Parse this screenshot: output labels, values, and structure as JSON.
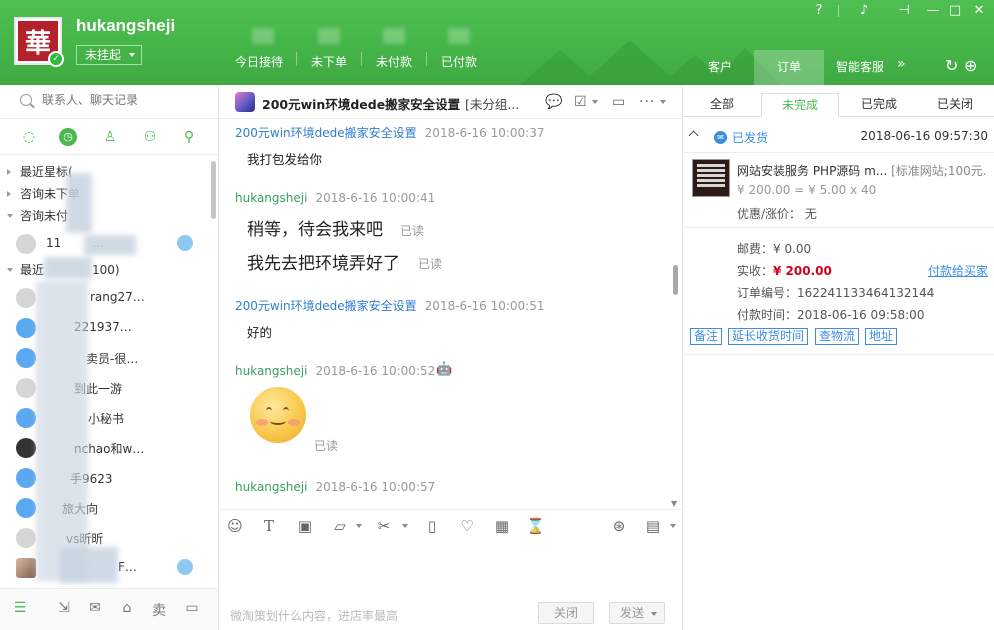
{
  "window": {
    "username": "hukangsheji",
    "avatar_char": "華",
    "status": "未挂起",
    "stats": [
      "今日接待",
      "未下单",
      "未付款",
      "已付款"
    ],
    "tabs": [
      "客户",
      "订单",
      "智能客服"
    ],
    "active_tab": "订单",
    "controls": [
      "help-icon",
      "sound-icon",
      "pin-icon",
      "minimize-icon",
      "maximize-icon",
      "close-icon"
    ]
  },
  "sidebar": {
    "search_placeholder": "联系人、聊天记录",
    "groups": [
      {
        "label": "最近星标(",
        "expanded": false
      },
      {
        "label": "咨询未下单",
        "expanded": false
      },
      {
        "label": "咨询未付",
        "expanded": true
      },
      {
        "label": "最近",
        "count": "100)",
        "expanded": true
      }
    ],
    "contacts": [
      {
        "name": "11",
        "suffix": "…"
      },
      {
        "name": "rang27…"
      },
      {
        "name": "221937…"
      },
      {
        "name": "卖员-很…"
      },
      {
        "name": "到此一游"
      },
      {
        "name": "小秘书"
      },
      {
        "name": "nchao和w…"
      },
      {
        "name": "手9623"
      },
      {
        "name": "旅大向"
      },
      {
        "name": "vs昕昕"
      },
      {
        "name": "F…"
      }
    ]
  },
  "chat": {
    "title": "200元win环境dede搬家安全设置",
    "title_suffix": "[未分组...",
    "messages": [
      {
        "sender": "200元win环境dede搬家安全设置",
        "time": "2018-6-16 10:00:37",
        "text": "我打包发给你"
      },
      {
        "sender": "hukangsheji",
        "time": "2018-6-16 10:00:41",
        "lines": [
          "稍等，待会我来吧",
          "我先去把环境弄好了"
        ],
        "read": "已读"
      },
      {
        "sender": "200元win环境dede搬家安全设置",
        "time": "2018-6-16 10:00:51",
        "text": "好的"
      },
      {
        "sender": "hukangsheji",
        "time": "2018-6-16 10:00:52",
        "read": "已读"
      },
      {
        "sender": "hukangsheji",
        "time": "2018-6-16 10:00:57"
      }
    ],
    "input_placeholder": "微淘策划什么内容，进店率最高",
    "close_label": "关闭",
    "send_label": "发送"
  },
  "order": {
    "tabs": [
      "全部",
      "未完成",
      "已完成",
      "已关闭"
    ],
    "active_tab": "未完成",
    "status": "已发货",
    "order_time": "2018-06-16 09:57:30",
    "product_title": "网站安装服务 PHP源码 m...",
    "product_sku": "[标准网站;100元...",
    "price_line": "¥ 200.00 = ¥ 5.00 x 40",
    "discount_label": "优惠/涨价：",
    "discount_value": "无",
    "postage": "邮费：¥ 0.00",
    "paid_label": "实收：",
    "paid_value": "¥ 200.00",
    "pay_link": "付款给买家",
    "order_no": "订单编号：162241133464132144",
    "pay_time": "付款时间：2018-06-16 09:58:00",
    "buttons": [
      "备注",
      "延长收货时间",
      "查物流",
      "地址"
    ]
  },
  "colors": {
    "brand": "#45b548",
    "link": "#3b8de0",
    "price": "#d0021b"
  }
}
